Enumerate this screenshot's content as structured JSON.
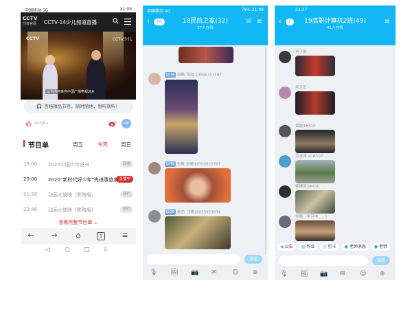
{
  "phone1": {
    "status_left": "中国移动 5G",
    "status_right": "21:08",
    "header_title": "CCTV-14少儿频道直播",
    "logo_text": "CCTV",
    "logo_sub": "节目官网",
    "video_logo": "CCTV",
    "video_logo_right": "CCTV少儿",
    "video_caption": "以下内容来自中国广播电视总台",
    "notice": "百档精品节目，随时随地，想听就听！",
    "likes": "922W+",
    "vip": "VIP",
    "schedule_title": "节目单",
    "days": [
      "周五",
      "今天",
      "周日"
    ],
    "schedule": [
      {
        "time": "19:00",
        "name": "2020中国少年说-8",
        "badge": "回看",
        "live": false
      },
      {
        "time": "20:00",
        "name": "2020“新时代好少年”先进事迹发布",
        "badge": "直播中",
        "live": true
      },
      {
        "time": "21:58",
        "name": "动画大放映（影院版）",
        "badge": "预约",
        "live": false
      },
      {
        "time": "22:46",
        "name": "动画大放映（影院版）",
        "badge": "预约",
        "live": false
      }
    ],
    "more": "查看完整节目单"
  },
  "phone2": {
    "status_left": "中国移动 4G",
    "status_right": "78% 21:09",
    "unread": "16",
    "group_title": "18民航之家(32)",
    "group_sub": "27人在线",
    "messages": [
      {
        "level": "LV14",
        "name": "白鹏",
        "text": "陈英 19956203567"
      },
      {
        "level": "LV49",
        "name": "彭敏",
        "text": "彭敏18705622767"
      },
      {
        "level": "LV26",
        "name": "黄浩",
        "text": "汪博18055923834"
      }
    ],
    "send": "发送"
  },
  "phone3": {
    "status_time": "22:37",
    "unread": "2",
    "group_title": "19高职计算机2班(49)",
    "group_sub": "41人在线",
    "members": [
      "刘子航",
      "吴天乐",
      "黄毅3#410",
      "范清涛 10#507",
      "韩博涛3#430",
      "甘鹏（学习中……）"
    ],
    "quick": [
      "公告",
      "作业",
      "打卡",
      "老师消息",
      "老师"
    ],
    "send": "发送"
  }
}
